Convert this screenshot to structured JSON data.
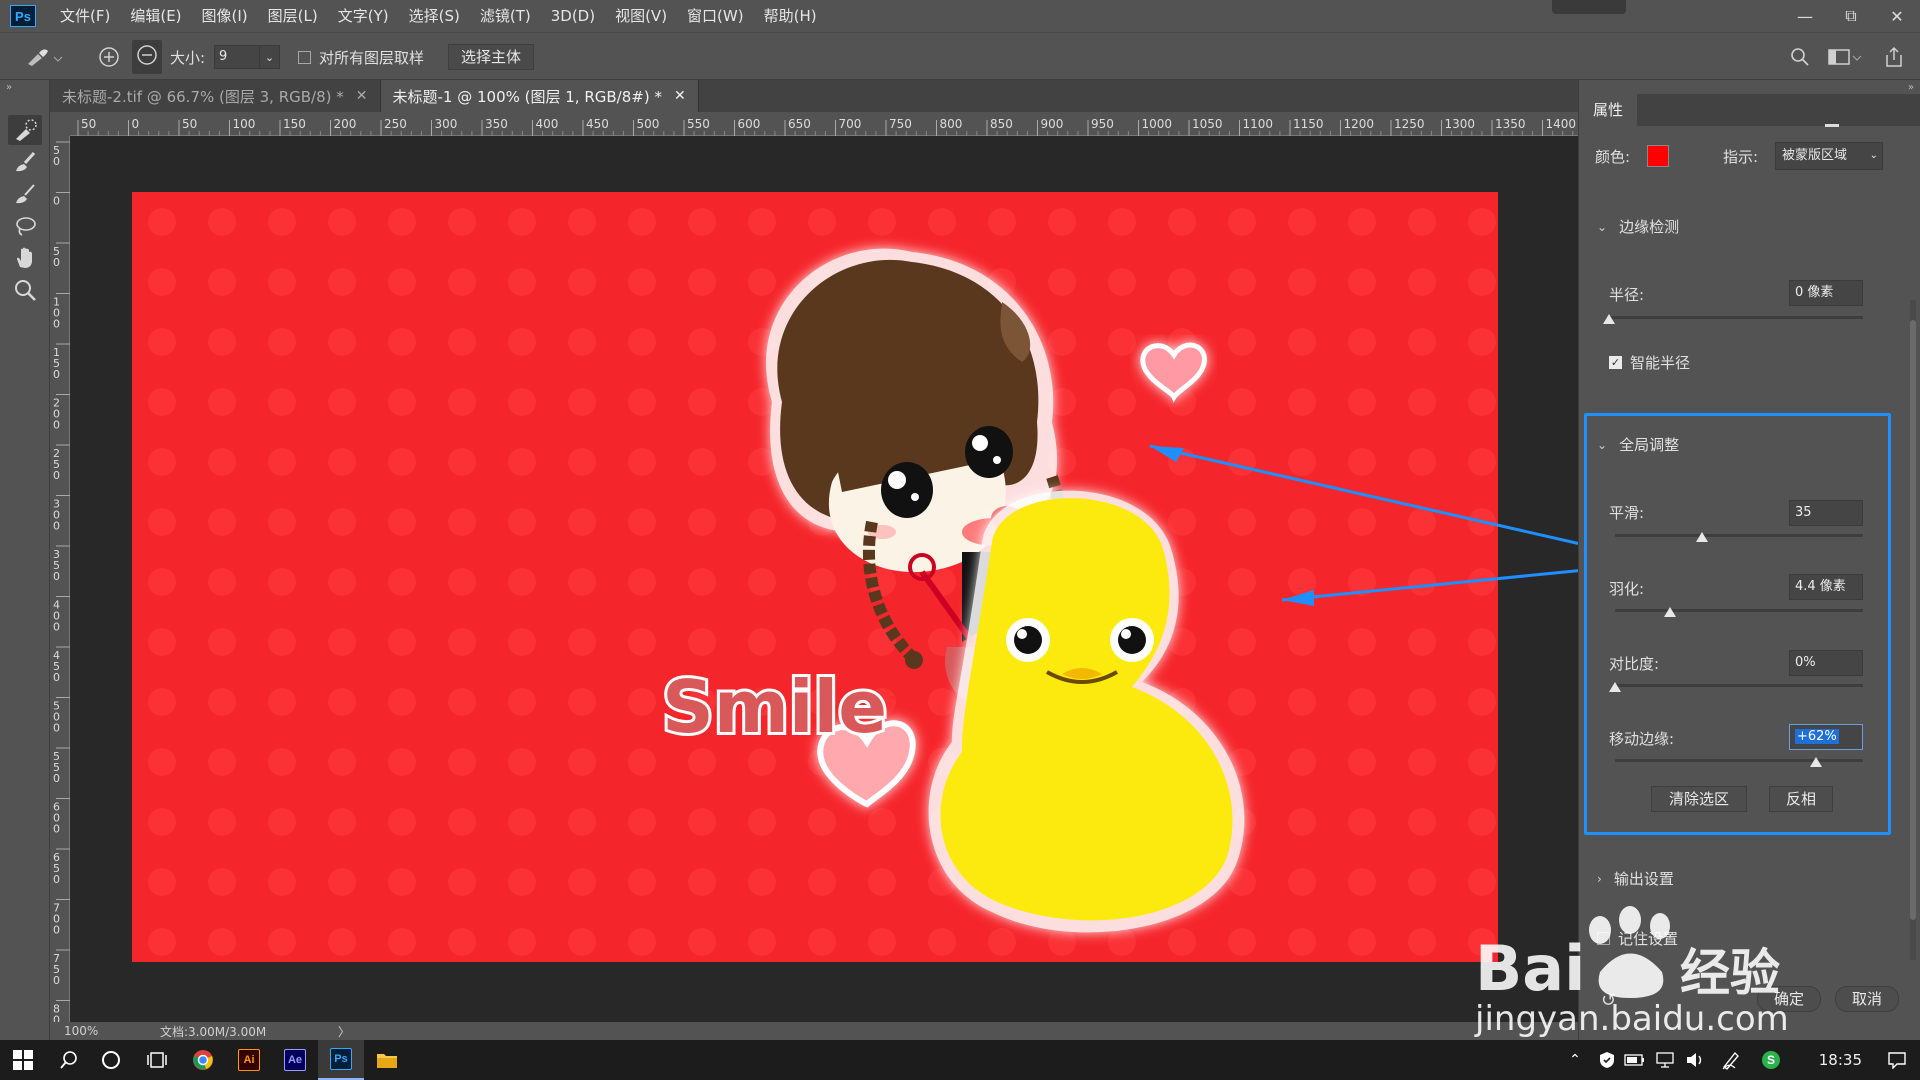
{
  "app": {
    "logo_text": "Ps"
  },
  "menu": [
    "文件(F)",
    "编辑(E)",
    "图像(I)",
    "图层(L)",
    "文字(Y)",
    "选择(S)",
    "滤镜(T)",
    "3D(D)",
    "视图(V)",
    "窗口(W)",
    "帮助(H)"
  ],
  "options": {
    "size_label": "大小:",
    "size_value": "9",
    "sample_all_label": "对所有图层取样",
    "select_subject_label": "选择主体"
  },
  "tabs": [
    {
      "label": "未标题-2.tif @ 66.7% (图层 3, RGB/8) *",
      "active": false
    },
    {
      "label": "未标题-1 @ 100% (图层 1, RGB/8#) *",
      "active": true
    }
  ],
  "ruler": {
    "top_ticks": [
      "50",
      "0",
      "50",
      "100",
      "150",
      "200",
      "250",
      "300",
      "350",
      "400",
      "450",
      "500",
      "550",
      "600",
      "650",
      "700",
      "750",
      "800",
      "850",
      "900",
      "950",
      "1000",
      "1050",
      "1100",
      "1150",
      "1200",
      "1250",
      "1300",
      "1350",
      "1400"
    ],
    "left_ticks": [
      "5\n0",
      "0",
      "5\n0",
      "1\n0\n0",
      "1\n5\n0",
      "2\n0\n0",
      "2\n5\n0",
      "3\n0\n0",
      "3\n5\n0",
      "4\n0\n0",
      "4\n5\n0",
      "5\n0\n0",
      "5\n5\n0",
      "6\n0\n0",
      "6\n5\n0",
      "7\n0\n0",
      "7\n5\n0",
      "8\n0"
    ]
  },
  "image": {
    "text": "Smile",
    "bg_color": "#f5262b"
  },
  "status": {
    "zoom": "100%",
    "doc": "文档:3.00M/3.00M",
    "arrow": "〉"
  },
  "panel": {
    "tab": "属性",
    "color_label": "颜色:",
    "color_value": "#ff0000",
    "indicate_label": "指示:",
    "indicate_value": "被蒙版区域",
    "edge_detect_title": "边缘检测",
    "radius_label": "半径:",
    "radius_value": "0 像素",
    "smart_radius_label": "智能半径",
    "smart_radius_checked": true,
    "global_title": "全局调整",
    "smooth_label": "平滑:",
    "smooth_value": "35",
    "smooth_level": 0.35,
    "feather_label": "羽化:",
    "feather_value": "4.4 像素",
    "feather_level": 0.22,
    "contrast_label": "对比度:",
    "contrast_value": "0%",
    "contrast_level": 0.0,
    "shift_label": "移动边缘:",
    "shift_value": "+62%",
    "shift_level": 0.81,
    "clear_btn": "清除选区",
    "invert_btn": "反相",
    "output_title": "输出设置",
    "remember_label": "记住设置",
    "ok_btn": "确定",
    "cancel_btn": "取消"
  },
  "taskbar": {
    "time": "18:35"
  },
  "watermark": {
    "line1": "Bai",
    "line2": "经验",
    "line3": "jingyan.baidu.com"
  }
}
